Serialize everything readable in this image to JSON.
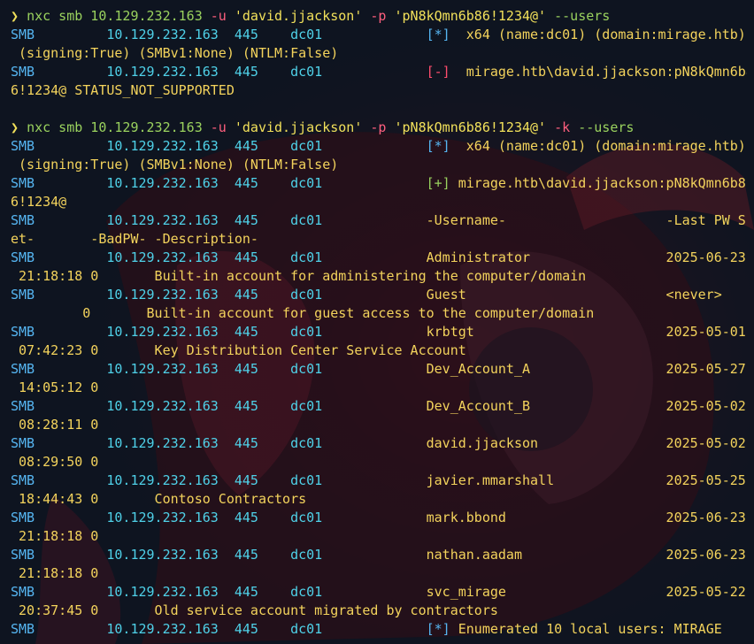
{
  "colors": {
    "background": "#0e1420",
    "prompt": "#f1e05a",
    "command": "#9ad25e",
    "flag": "#ff5f7e",
    "smb": "#56b6f2",
    "field": "#4fd1e8",
    "text": "#f3d35c",
    "error": "#ff4d6d",
    "ok": "#9ad25e"
  },
  "lines": [
    {
      "segs": [
        {
          "c": "prompt",
          "t": "❯ "
        },
        {
          "c": "cmd",
          "t": "nxc smb 10.129.232.163 "
        },
        {
          "c": "flag",
          "t": "-u"
        },
        {
          "c": "str",
          "t": " 'david.jjackson' "
        },
        {
          "c": "flag",
          "t": "-p"
        },
        {
          "c": "str",
          "t": " 'pN8kQmn6b86!1234@' "
        },
        {
          "c": "cmd",
          "t": "--users"
        }
      ]
    },
    {
      "segs": [
        {
          "c": "blue",
          "t": "SMB"
        },
        {
          "c": "cyan",
          "t": "         10.129.232.163  445    dc01            "
        },
        {
          "c": "blue",
          "t": " [*] "
        },
        {
          "c": "yel",
          "t": " x64 (name:dc01) (domain:mirage.htb)"
        }
      ]
    },
    {
      "segs": [
        {
          "c": "yel",
          "t": " (signing:True) (SMBv1:None) (NTLM:False)"
        }
      ]
    },
    {
      "segs": [
        {
          "c": "blue",
          "t": "SMB"
        },
        {
          "c": "cyan",
          "t": "         10.129.232.163  445    dc01            "
        },
        {
          "c": "red",
          "t": " [-] "
        },
        {
          "c": "yel",
          "t": " mirage.htb\\david.jjackson:pN8kQmn6b8"
        }
      ]
    },
    {
      "segs": [
        {
          "c": "yel",
          "t": "6!1234@ STATUS_NOT_SUPPORTED"
        }
      ]
    },
    {
      "segs": [
        {
          "c": "yel",
          "t": ""
        }
      ]
    },
    {
      "segs": [
        {
          "c": "prompt",
          "t": "❯ "
        },
        {
          "c": "cmd",
          "t": "nxc smb 10.129.232.163 "
        },
        {
          "c": "flag",
          "t": "-u"
        },
        {
          "c": "str",
          "t": " 'david.jjackson' "
        },
        {
          "c": "flag",
          "t": "-p"
        },
        {
          "c": "str",
          "t": " 'pN8kQmn6b86!1234@' "
        },
        {
          "c": "flag",
          "t": "-k"
        },
        {
          "c": "cmd",
          "t": " --users"
        }
      ]
    },
    {
      "segs": [
        {
          "c": "blue",
          "t": "SMB"
        },
        {
          "c": "cyan",
          "t": "         10.129.232.163  445    dc01            "
        },
        {
          "c": "blue",
          "t": " [*] "
        },
        {
          "c": "yel",
          "t": " x64 (name:dc01) (domain:mirage.htb)"
        }
      ]
    },
    {
      "segs": [
        {
          "c": "yel",
          "t": " (signing:True) (SMBv1:None) (NTLM:False)"
        }
      ]
    },
    {
      "segs": [
        {
          "c": "blue",
          "t": "SMB"
        },
        {
          "c": "cyan",
          "t": "         10.129.232.163  445    dc01            "
        },
        {
          "c": "grn",
          "t": " [+] "
        },
        {
          "c": "yel",
          "t": "mirage.htb\\david.jjackson:pN8kQmn6b8"
        }
      ]
    },
    {
      "segs": [
        {
          "c": "yel",
          "t": "6!1234@"
        }
      ]
    },
    {
      "segs": [
        {
          "c": "blue",
          "t": "SMB"
        },
        {
          "c": "cyan",
          "t": "         10.129.232.163  445    dc01            "
        },
        {
          "c": "yel",
          "t": " -Username-                    -Last PW S"
        }
      ]
    },
    {
      "segs": [
        {
          "c": "yel",
          "t": "et-       -BadPW- -Description-"
        }
      ]
    },
    {
      "segs": [
        {
          "c": "blue",
          "t": "SMB"
        },
        {
          "c": "cyan",
          "t": "         10.129.232.163  445    dc01            "
        },
        {
          "c": "yel",
          "t": " Administrator                 2025-06-23"
        }
      ]
    },
    {
      "segs": [
        {
          "c": "yel",
          "t": " 21:18:18 0       Built-in account for administering the computer/domain"
        }
      ]
    },
    {
      "segs": [
        {
          "c": "blue",
          "t": "SMB"
        },
        {
          "c": "cyan",
          "t": "         10.129.232.163  445    dc01            "
        },
        {
          "c": "yel",
          "t": " Guest                         <never>"
        }
      ]
    },
    {
      "segs": [
        {
          "c": "yel",
          "t": "         0       Built-in account for guest access to the computer/domain"
        }
      ]
    },
    {
      "segs": [
        {
          "c": "blue",
          "t": "SMB"
        },
        {
          "c": "cyan",
          "t": "         10.129.232.163  445    dc01            "
        },
        {
          "c": "yel",
          "t": " krbtgt                        2025-05-01"
        }
      ]
    },
    {
      "segs": [
        {
          "c": "yel",
          "t": " 07:42:23 0       Key Distribution Center Service Account"
        }
      ]
    },
    {
      "segs": [
        {
          "c": "blue",
          "t": "SMB"
        },
        {
          "c": "cyan",
          "t": "         10.129.232.163  445    dc01            "
        },
        {
          "c": "yel",
          "t": " Dev_Account_A                 2025-05-27"
        }
      ]
    },
    {
      "segs": [
        {
          "c": "yel",
          "t": " 14:05:12 0"
        }
      ]
    },
    {
      "segs": [
        {
          "c": "blue",
          "t": "SMB"
        },
        {
          "c": "cyan",
          "t": "         10.129.232.163  445    dc01            "
        },
        {
          "c": "yel",
          "t": " Dev_Account_B                 2025-05-02"
        }
      ]
    },
    {
      "segs": [
        {
          "c": "yel",
          "t": " 08:28:11 0"
        }
      ]
    },
    {
      "segs": [
        {
          "c": "blue",
          "t": "SMB"
        },
        {
          "c": "cyan",
          "t": "         10.129.232.163  445    dc01            "
        },
        {
          "c": "yel",
          "t": " david.jjackson                2025-05-02"
        }
      ]
    },
    {
      "segs": [
        {
          "c": "yel",
          "t": " 08:29:50 0"
        }
      ]
    },
    {
      "segs": [
        {
          "c": "blue",
          "t": "SMB"
        },
        {
          "c": "cyan",
          "t": "         10.129.232.163  445    dc01            "
        },
        {
          "c": "yel",
          "t": " javier.mmarshall              2025-05-25"
        }
      ]
    },
    {
      "segs": [
        {
          "c": "yel",
          "t": " 18:44:43 0       Contoso Contractors"
        }
      ]
    },
    {
      "segs": [
        {
          "c": "blue",
          "t": "SMB"
        },
        {
          "c": "cyan",
          "t": "         10.129.232.163  445    dc01            "
        },
        {
          "c": "yel",
          "t": " mark.bbond                    2025-06-23"
        }
      ]
    },
    {
      "segs": [
        {
          "c": "yel",
          "t": " 21:18:18 0"
        }
      ]
    },
    {
      "segs": [
        {
          "c": "blue",
          "t": "SMB"
        },
        {
          "c": "cyan",
          "t": "         10.129.232.163  445    dc01            "
        },
        {
          "c": "yel",
          "t": " nathan.aadam                  2025-06-23"
        }
      ]
    },
    {
      "segs": [
        {
          "c": "yel",
          "t": " 21:18:18 0"
        }
      ]
    },
    {
      "segs": [
        {
          "c": "blue",
          "t": "SMB"
        },
        {
          "c": "cyan",
          "t": "         10.129.232.163  445    dc01            "
        },
        {
          "c": "yel",
          "t": " svc_mirage                    2025-05-22"
        }
      ]
    },
    {
      "segs": [
        {
          "c": "yel",
          "t": " 20:37:45 0       Old service account migrated by contractors"
        }
      ]
    },
    {
      "segs": [
        {
          "c": "blue",
          "t": "SMB"
        },
        {
          "c": "cyan",
          "t": "         10.129.232.163  445    dc01            "
        },
        {
          "c": "blue",
          "t": " [*] "
        },
        {
          "c": "yel",
          "t": "Enumerated 10 local users: MIRAGE"
        }
      ]
    }
  ]
}
